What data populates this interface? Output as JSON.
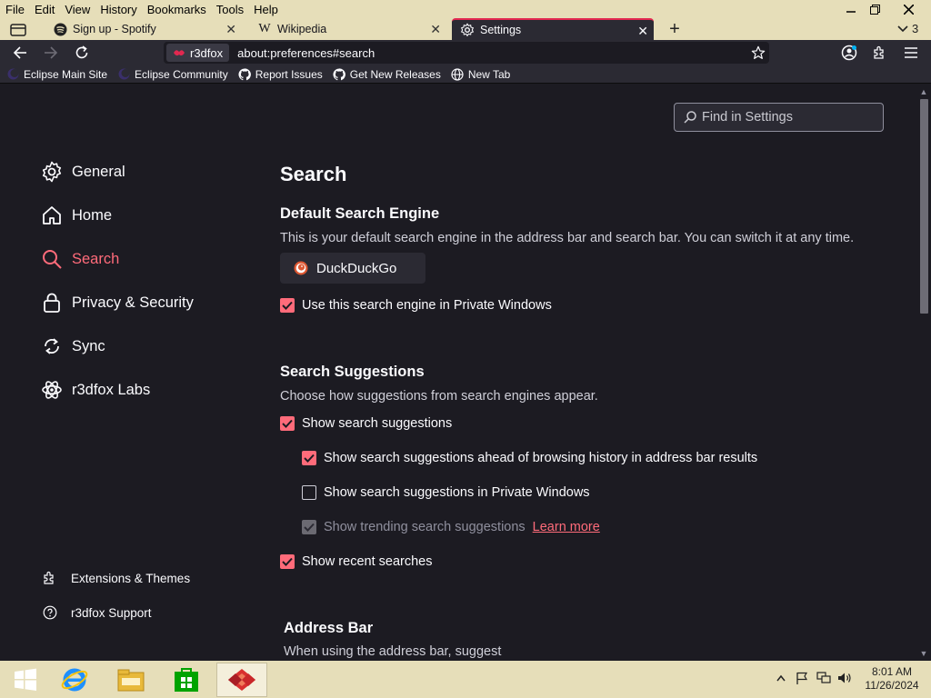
{
  "menubar": {
    "items": [
      "File",
      "Edit",
      "View",
      "History",
      "Bookmarks",
      "Tools",
      "Help"
    ]
  },
  "tabs": [
    {
      "label": "Sign up - Spotify",
      "icon": "spotify-icon"
    },
    {
      "label": "Wikipedia",
      "icon": "wikipedia-icon"
    },
    {
      "label": "Settings",
      "icon": "gear-icon"
    }
  ],
  "tab_overflow_count": "3",
  "navbar": {
    "identity_label": "r3dfox",
    "url": "about:preferences#search"
  },
  "bookmarks": [
    {
      "label": "Eclipse Main Site",
      "icon": "eclipse-icon"
    },
    {
      "label": "Eclipse Community",
      "icon": "eclipse-icon"
    },
    {
      "label": "Report Issues",
      "icon": "github-icon"
    },
    {
      "label": "Get New Releases",
      "icon": "github-icon"
    },
    {
      "label": "New Tab",
      "icon": "globe-icon"
    }
  ],
  "find": {
    "placeholder": "Find in Settings"
  },
  "sidebar": {
    "categories": [
      {
        "label": "General",
        "icon": "gear-icon"
      },
      {
        "label": "Home",
        "icon": "home-icon"
      },
      {
        "label": "Search",
        "icon": "search-icon",
        "selected": true
      },
      {
        "label": "Privacy & Security",
        "icon": "lock-icon"
      },
      {
        "label": "Sync",
        "icon": "sync-icon"
      },
      {
        "label": "r3dfox Labs",
        "icon": "labs-icon"
      }
    ],
    "footer": [
      {
        "label": "Extensions & Themes",
        "icon": "puzzle-icon"
      },
      {
        "label": "r3dfox Support",
        "icon": "help-icon"
      }
    ]
  },
  "main": {
    "title": "Search",
    "default_engine": {
      "heading": "Default Search Engine",
      "description": "This is your default search engine in the address bar and search bar. You can switch it at any time.",
      "engine": "DuckDuckGo",
      "private_checkbox": "Use this search engine in Private Windows"
    },
    "suggestions": {
      "heading": "Search Suggestions",
      "description": "Choose how suggestions from search engines appear.",
      "show_suggestions": "Show search suggestions",
      "ahead_of_history": "Show search suggestions ahead of browsing history in address bar results",
      "in_private": "Show search suggestions in Private Windows",
      "trending": "Show trending search suggestions",
      "learn_more": "Learn more",
      "recent": "Show recent searches"
    },
    "address_bar": {
      "heading": "Address Bar",
      "description": "When using the address bar, suggest"
    }
  },
  "taskbar": {
    "time": "8:01 AM",
    "date": "11/26/2024"
  },
  "colors": {
    "accent": "#ff6b7a",
    "tab_accent": "#e22850",
    "chrome_bg": "#e6deb9",
    "content_bg": "#1c1b22",
    "toolbar_bg": "#2b2a33"
  }
}
